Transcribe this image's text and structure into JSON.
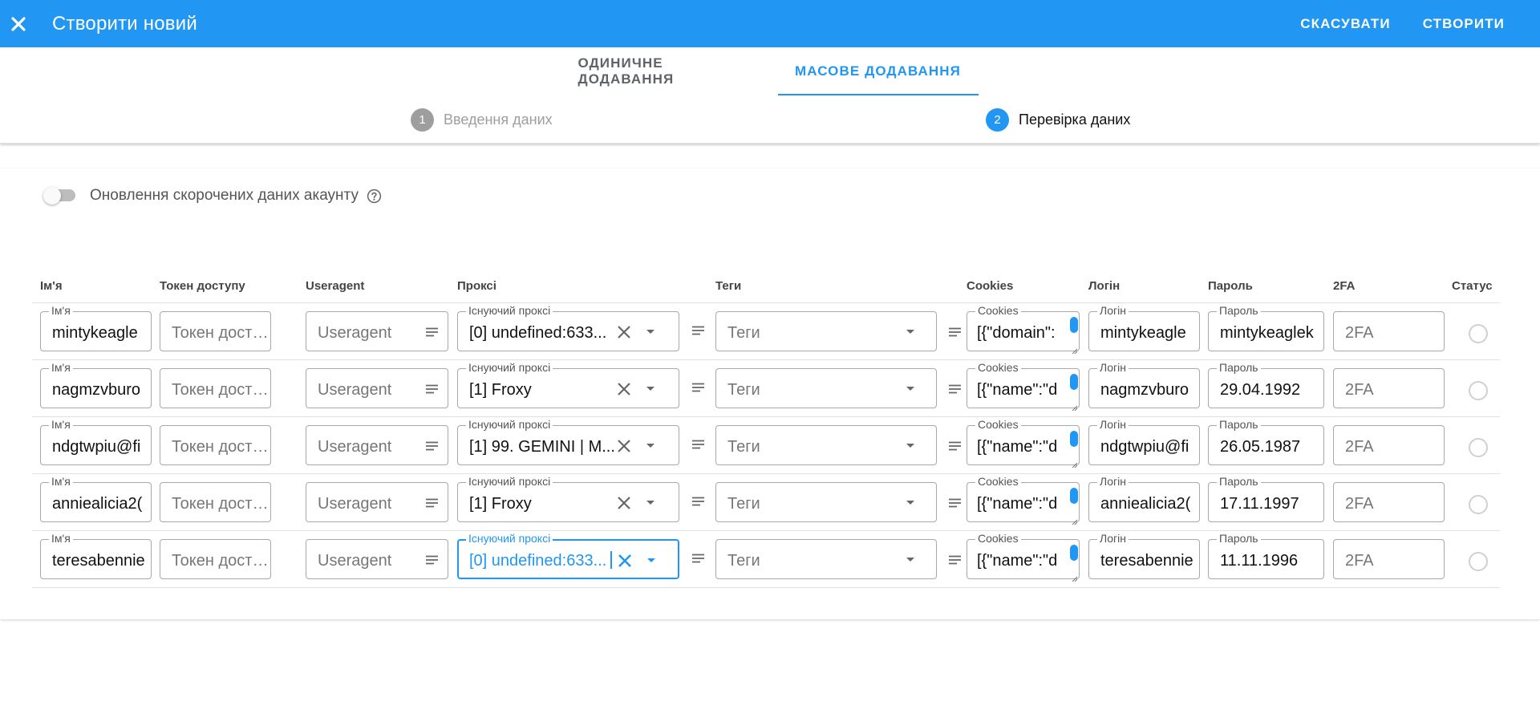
{
  "header": {
    "title": "Створити новий",
    "cancel_label": "СКАСУВАТИ",
    "create_label": "СТВОРИТИ",
    "color": "#2196f3"
  },
  "tabs": [
    {
      "label": "ОДИНИЧНЕ ДОДАВАННЯ",
      "active": false
    },
    {
      "label": "МАСОВЕ ДОДАВАННЯ",
      "active": true
    }
  ],
  "stepper": {
    "steps": [
      {
        "num": "1",
        "label": "Введення даних",
        "active": false
      },
      {
        "num": "2",
        "label": "Перевірка даних",
        "active": true
      }
    ]
  },
  "toggle": {
    "label": "Оновлення скорочених даних акаунту",
    "checked": false
  },
  "table": {
    "headers": {
      "name": "Ім'я",
      "token": "Токен доступу",
      "useragent": "Useragent",
      "proxy": "Проксі",
      "tags": "Теги",
      "cookies": "Cookies",
      "login": "Логін",
      "password": "Пароль",
      "twofa": "2FA",
      "status": "Статус"
    },
    "field_labels": {
      "name": "Ім'я",
      "proxy": "Існуючий проксі",
      "cookies": "Cookies",
      "login": "Логін",
      "password": "Пароль"
    },
    "placeholders": {
      "token": "Токен досту...",
      "useragent": "Useragent",
      "tags": "Теги",
      "twofa": "2FA"
    },
    "rows": [
      {
        "name": "mintykeagle",
        "proxy": "[0] undefined:633...",
        "cookies": "[{\"domain\":",
        "login": "mintykeagle",
        "password": "mintykeaglek"
      },
      {
        "name": "nagmzvburo",
        "proxy": "[1] Froxy",
        "cookies": "[{\"name\":\"d",
        "login": "nagmzvburo",
        "password": "29.04.1992"
      },
      {
        "name": "ndgtwpiu@fi",
        "proxy": "[1] 99. GEMINI | M...",
        "cookies": "[{\"name\":\"d",
        "login": "ndgtwpiu@fi",
        "password": "26.05.1987"
      },
      {
        "name": "anniealicia2(",
        "proxy": "[1] Froxy",
        "cookies": "[{\"name\":\"d",
        "login": "anniealicia2(",
        "password": "17.11.1997"
      },
      {
        "name": "teresabennie",
        "proxy": "[0] undefined:633...",
        "cookies": "[{\"name\":\"d",
        "login": "teresabennie",
        "password": "11.11.1996"
      }
    ]
  }
}
